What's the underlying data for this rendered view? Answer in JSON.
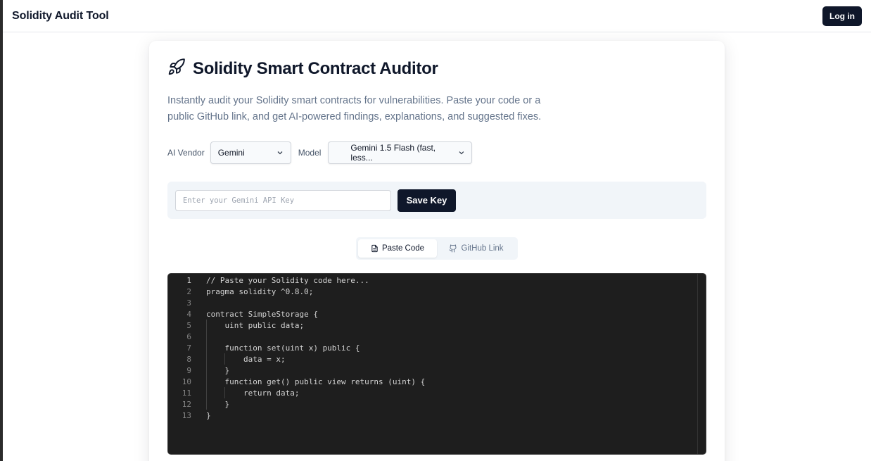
{
  "topbar": {
    "app_title": "Solidity Audit Tool",
    "login_label": "Log in"
  },
  "card": {
    "title": "Solidity Smart Contract Auditor",
    "title_icon": "rocket-icon",
    "description": "Instantly audit your Solidity smart contracts for vulnerabilities. Paste your code or a public GitHub link, and get AI-powered findings, explanations, and suggested fixes."
  },
  "selectors": {
    "vendor_label": "AI Vendor",
    "vendor_value": "Gemini",
    "model_label": "Model",
    "model_value": "Gemini 1.5 Flash (fast, less..."
  },
  "apikey": {
    "placeholder": "Enter your Gemini API Key",
    "value": "",
    "save_label": "Save Key"
  },
  "tabs": [
    {
      "label": "Paste Code",
      "icon": "file-text-icon",
      "active": true
    },
    {
      "label": "GitHub Link",
      "icon": "github-icon",
      "active": false
    }
  ],
  "editor": {
    "current_line": 1,
    "lines": [
      {
        "num": "1",
        "text": "// Paste your Solidity code here..."
      },
      {
        "num": "2",
        "text": "pragma solidity ^0.8.0;"
      },
      {
        "num": "3",
        "text": ""
      },
      {
        "num": "4",
        "text": "contract SimpleStorage {"
      },
      {
        "num": "5",
        "text": "    uint public data;"
      },
      {
        "num": "6",
        "text": ""
      },
      {
        "num": "7",
        "text": "    function set(uint x) public {"
      },
      {
        "num": "8",
        "text": "        data = x;"
      },
      {
        "num": "9",
        "text": "    }"
      },
      {
        "num": "10",
        "text": "    function get() public view returns (uint) {"
      },
      {
        "num": "11",
        "text": "        return data;"
      },
      {
        "num": "12",
        "text": "    }"
      },
      {
        "num": "13",
        "text": "}"
      }
    ]
  },
  "colors": {
    "primary": "#0f172a",
    "muted_text": "#64748b",
    "panel_bg": "#f1f5f9",
    "editor_bg": "#1e1e1e"
  }
}
